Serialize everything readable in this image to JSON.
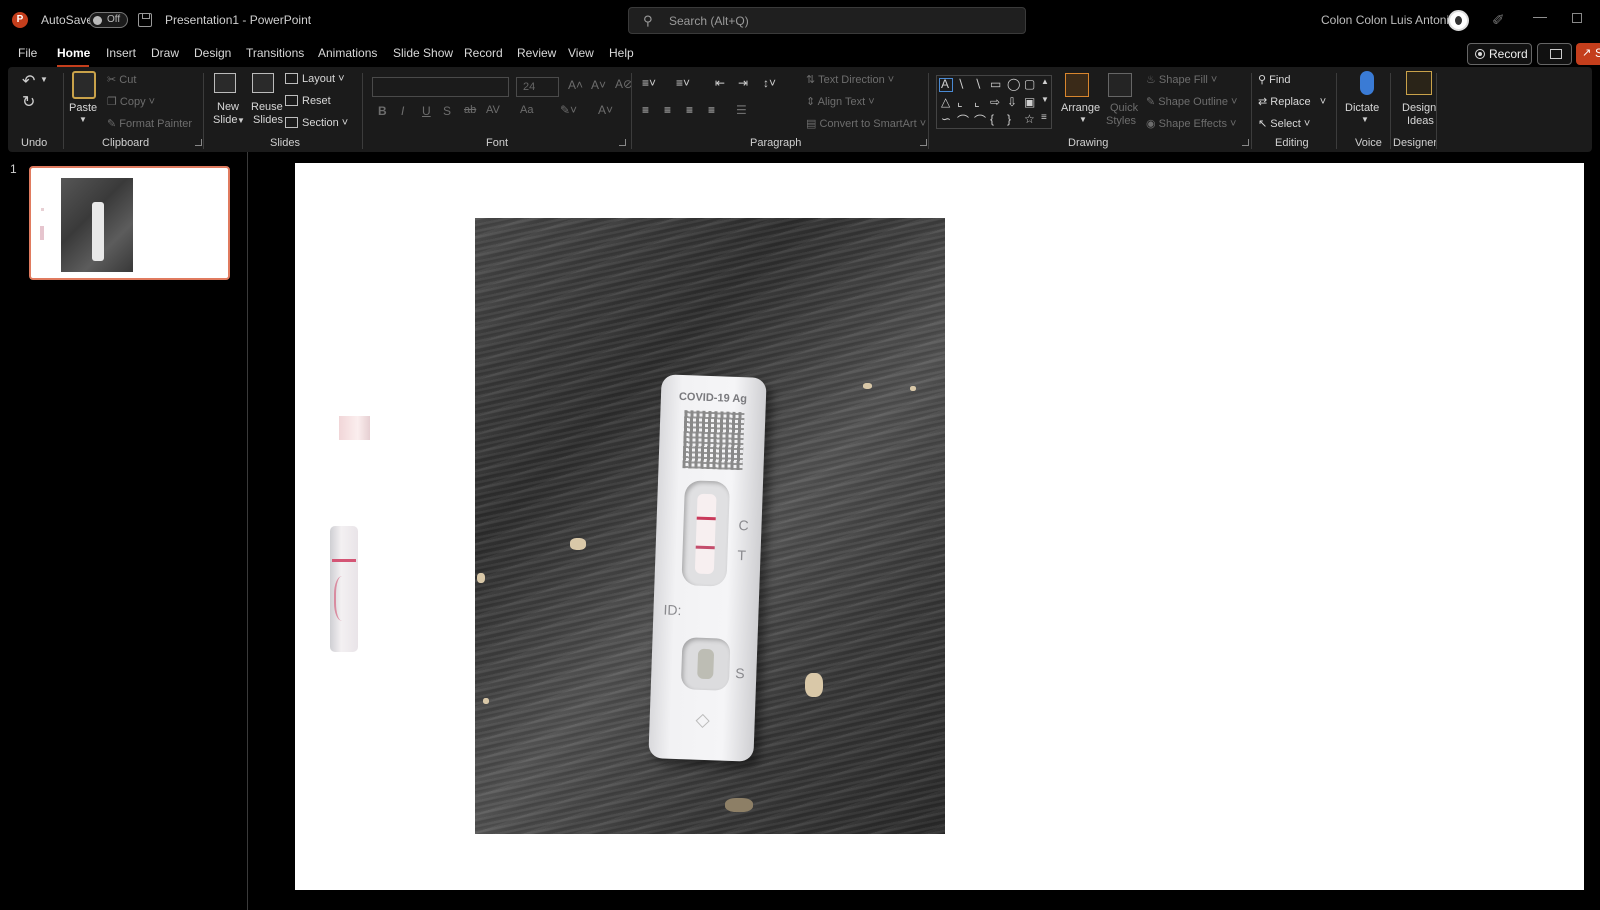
{
  "app": {
    "logo": "P",
    "autosave_label": "AutoSave",
    "autosave_state": "Off",
    "document_title": "Presentation1 - PowerPoint",
    "search_placeholder": "Search (Alt+Q)",
    "user_name": "Colon Colon Luis Antonio",
    "accent_color": "#c43e1c"
  },
  "menu": {
    "items": [
      "File",
      "Home",
      "Insert",
      "Draw",
      "Design",
      "Transitions",
      "Animations",
      "Slide Show",
      "Record",
      "Review",
      "View",
      "Help"
    ],
    "active": "Home",
    "record_label": "Record",
    "share_label": "S"
  },
  "ribbon": {
    "groups": {
      "undo": "Undo",
      "clipboard": "Clipboard",
      "slides": "Slides",
      "font": "Font",
      "paragraph": "Paragraph",
      "drawing": "Drawing",
      "editing": "Editing",
      "voice": "Voice",
      "designer": "Designer"
    },
    "clipboard": {
      "paste": "Paste",
      "cut": "Cut",
      "copy": "Copy",
      "format_painter": "Format Painter"
    },
    "slides": {
      "new_slide_1": "New",
      "new_slide_2": "Slide",
      "reuse_1": "Reuse",
      "reuse_2": "Slides",
      "layout": "Layout",
      "reset": "Reset",
      "section": "Section"
    },
    "font": {
      "size": "24",
      "bold": "B",
      "italic": "I",
      "underline": "U",
      "strike": "ab",
      "shadow": "S",
      "spacing": "AV",
      "case": "Aa",
      "grow": "A˄",
      "shrink": "A˅"
    },
    "paragraph": {
      "text_direction": "Text Direction",
      "align_text": "Align Text",
      "convert_smartart": "Convert to SmartArt"
    },
    "drawing": {
      "arrange": "Arrange",
      "quick_styles_1": "Quick",
      "quick_styles_2": "Styles",
      "shape_fill": "Shape Fill",
      "shape_outline": "Shape Outline",
      "shape_effects": "Shape Effects"
    },
    "editing": {
      "find": "Find",
      "replace": "Replace",
      "select": "Select"
    },
    "voice": {
      "dictate": "Dictate"
    },
    "designer": {
      "design_ideas_1": "Design",
      "design_ideas_2": "Ideas"
    }
  },
  "slides_pane": {
    "slide_number": "1"
  },
  "slide": {
    "test": {
      "title": "COVID-19 Ag",
      "label_c": "C",
      "label_t": "T",
      "label_id": "ID:",
      "label_s": "S"
    }
  }
}
